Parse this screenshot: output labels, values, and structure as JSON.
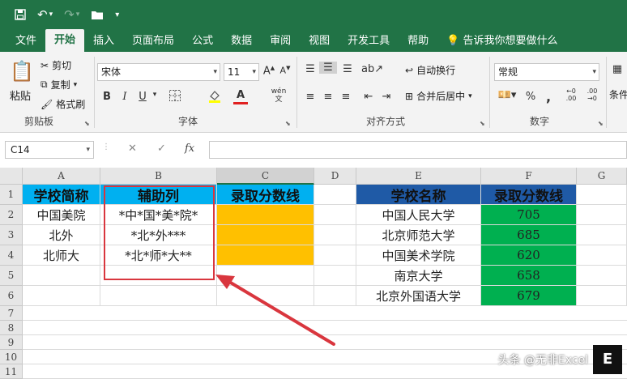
{
  "titlebar": {
    "icons": [
      "save-icon",
      "undo-icon",
      "redo-icon",
      "open-folder-icon",
      "customize-icon"
    ]
  },
  "tabs": [
    "文件",
    "开始",
    "插入",
    "页面布局",
    "公式",
    "数据",
    "审阅",
    "视图",
    "开发工具",
    "帮助",
    "告诉我你想要做什么"
  ],
  "active_tab": "开始",
  "ribbon": {
    "clipboard": {
      "paste": "粘贴",
      "cut": "剪切",
      "copy": "复制",
      "format_painter": "格式刷",
      "label": "剪贴板"
    },
    "font": {
      "name": "宋体",
      "size": "11",
      "label": "字体",
      "bold": "B",
      "italic": "I",
      "underline": "U",
      "font_color_glyph": "A",
      "phonetic": "wén"
    },
    "alignment": {
      "wrap": "自动换行",
      "merge": "合并后居中",
      "label": "对齐方式"
    },
    "number": {
      "format": "常规",
      "percent": "%",
      "comma": ",",
      "label": "数字"
    },
    "styles": {
      "conditional": "条件"
    }
  },
  "formula_bar": {
    "cell_ref": "C14",
    "cancel": "✕",
    "enter": "✓",
    "fx": "fx",
    "content": ""
  },
  "columns": [
    "A",
    "B",
    "C",
    "D",
    "E",
    "F",
    "G"
  ],
  "selected_column": "C",
  "rows": [
    "1",
    "2",
    "3",
    "4",
    "5",
    "6",
    "7",
    "8",
    "9",
    "10",
    "11"
  ],
  "sheet": {
    "A1": "学校简称",
    "B1": "辅助列",
    "C1": "录取分数线",
    "A2": "中国美院",
    "B2": "*中*国*美*院*",
    "A3": "北外",
    "B3": "*北*外***",
    "A4": "北师大",
    "B4": "*北*师*大**",
    "E1": "学校名称",
    "F1": "录取分数线",
    "E2": "中国人民大学",
    "F2": "705",
    "E3": "北京师范大学",
    "F3": "685",
    "E4": "中国美术学院",
    "F4": "620",
    "E5": "南京大学",
    "F5": "658",
    "E6": "北京外国语大学",
    "F6": "679"
  },
  "colors": {
    "excel_green": "#217346",
    "header_blue": "#00b0f0",
    "header_navy": "#1f5aa6",
    "fill_orange": "#ffc000",
    "fill_green": "#00b050",
    "highlight_red": "#d9363e"
  },
  "watermark": {
    "text": "头条 @无非Excel",
    "logo": "E"
  }
}
